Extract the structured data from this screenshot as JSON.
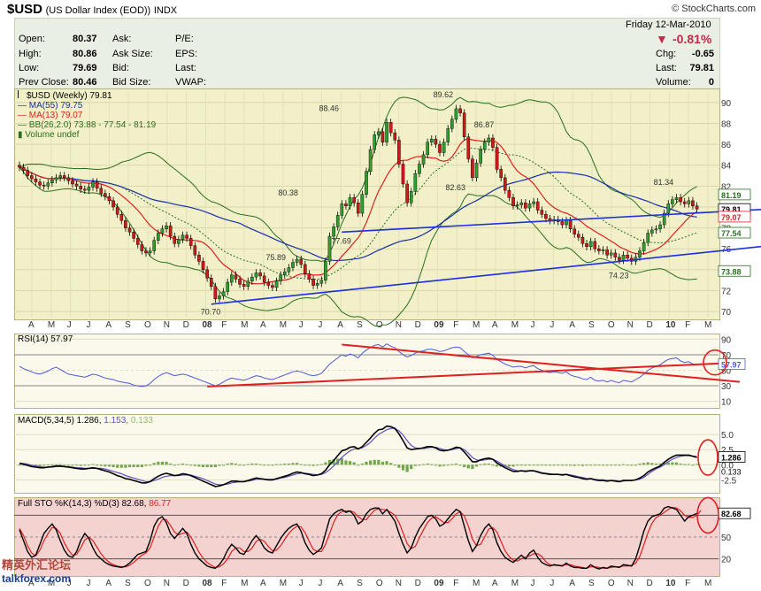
{
  "header": {
    "symbol": "$USD",
    "description": "(US Dollar Index (EOD))",
    "exchange": "INDX",
    "brand": "© StockCharts.com"
  },
  "quote": {
    "date": "Friday   12-Mar-2010",
    "change_pct": "-0.81%",
    "rows_left": [
      [
        "Open:",
        "80.37"
      ],
      [
        "High:",
        "80.86"
      ],
      [
        "Low:",
        "79.69"
      ],
      [
        "Prev Close:",
        "80.46"
      ]
    ],
    "rows_mid": [
      "Ask:",
      "Ask Size:",
      "Bid:",
      "Bid Size:"
    ],
    "rows_right": [
      "P/E:",
      "EPS:",
      "Last:",
      "VWAP:"
    ],
    "rows_far": [
      [
        "Chg:",
        "-0.65"
      ],
      [
        "Last:",
        "79.81"
      ],
      [
        "Volume:",
        "0"
      ]
    ]
  },
  "legend": {
    "price": "$USD (Weekly) 79.81",
    "ma55": "MA(55) 79.75",
    "ma13": "MA(13) 79.07",
    "bb": "BB(26,2.0) 73.88 - 77.54 - 81.19",
    "volume": "Volume undef",
    "rsi": "RSI(14) 57.97",
    "macd_a": "MACD(5,34,5) 1.286,",
    "macd_b": "1.153,",
    "macd_c": "0.133",
    "sto_a": "Full STO %K(14,3) %D(3) 82.68,",
    "sto_b": "86.77"
  },
  "colors": {
    "up": "#2e9e2e",
    "down": "#d01818",
    "ma55": "#1a2fa8",
    "ma13": "#e02020",
    "bb": "#2a6e20",
    "trend": "#1c2ee0",
    "rsi_line": "#4d5ad8",
    "red_trend": "#e02020",
    "macd": "#000000",
    "signal": "#6050c0",
    "hist": "#6ea84a",
    "circle": "#e02020"
  },
  "watermark": {
    "line1": "精英外汇论坛",
    "line2": "talkforex.com"
  },
  "chart_data": [
    {
      "type": "candlestick",
      "title": "$USD (Weekly) 79.81",
      "x_months": [
        "A",
        "M",
        "J",
        "J",
        "A",
        "S",
        "O",
        "N",
        "D",
        "08",
        "F",
        "M",
        "A",
        "M",
        "J",
        "J",
        "A",
        "S",
        "O",
        "N",
        "D",
        "09",
        "F",
        "M",
        "A",
        "M",
        "J",
        "J",
        "A",
        "S",
        "O",
        "N",
        "D",
        "10",
        "F",
        "M"
      ],
      "ylim": [
        69.5,
        91
      ],
      "y_ticks": [
        70,
        72,
        74,
        76,
        78,
        80,
        82,
        84,
        86,
        88,
        90
      ],
      "close_path": [
        83.8,
        83.5,
        83.0,
        82.7,
        82.4,
        82.1,
        82.0,
        82.3,
        82.6,
        82.8,
        83.0,
        82.8,
        82.5,
        82.2,
        82.0,
        81.7,
        81.6,
        81.9,
        82.4,
        81.8,
        81.3,
        81.0,
        80.6,
        80.0,
        79.3,
        78.7,
        78.0,
        77.6,
        77.0,
        76.4,
        75.8,
        75.6,
        75.8,
        76.8,
        77.5,
        77.9,
        78.2,
        77.2,
        76.5,
        76.9,
        77.3,
        77.0,
        76.3,
        75.4,
        74.8,
        74.0,
        73.2,
        72.4,
        71.2,
        71.5,
        71.9,
        72.8,
        73.5,
        73.1,
        72.6,
        72.4,
        72.9,
        73.3,
        73.7,
        73.4,
        72.8,
        72.5,
        72.3,
        72.9,
        73.5,
        73.8,
        74.2,
        74.7,
        75.0,
        74.5,
        73.6,
        73.1,
        72.5,
        72.7,
        73.0,
        74.8,
        77.2,
        78.1,
        79.2,
        80.3,
        80.1,
        80.9,
        80.4,
        79.4,
        81.2,
        83.4,
        85.5,
        86.9,
        87.2,
        86.2,
        88.1,
        87.1,
        86.4,
        84.1,
        82.2,
        80.4,
        81.5,
        83.2,
        84.1,
        85.0,
        86.2,
        86.5,
        86.0,
        85.2,
        86.2,
        87.5,
        88.4,
        89.4,
        89.0,
        86.7,
        84.6,
        82.8,
        84.2,
        85.5,
        86.2,
        86.6,
        85.7,
        83.6,
        82.8,
        81.6,
        80.9,
        80.1,
        80.2,
        80.4,
        79.9,
        80.3,
        80.5,
        79.7,
        79.3,
        78.9,
        78.7,
        78.8,
        78.6,
        78.3,
        78.7,
        77.9,
        77.4,
        77.1,
        76.5,
        76.2,
        76.7,
        76.0,
        75.8,
        75.9,
        75.4,
        75.6,
        75.2,
        74.9,
        75.4,
        75.1,
        74.8,
        75.2,
        75.8,
        76.6,
        77.5,
        77.8,
        77.9,
        78.3,
        79.4,
        80.3,
        80.7,
        80.9,
        80.5,
        80.3,
        80.6,
        80.1,
        79.8
      ],
      "annotations": [
        {
          "text": "88.46",
          "x": 76,
          "y": 89.2
        },
        {
          "text": "89.62",
          "x": 104,
          "y": 90.5
        },
        {
          "text": "86.87",
          "x": 114,
          "y": 87.6
        },
        {
          "text": "80.38",
          "x": 66,
          "y": 81.1
        },
        {
          "text": "82.63",
          "x": 107,
          "y": 81.6
        },
        {
          "text": "77.69",
          "x": 79,
          "y": 76.5
        },
        {
          "text": "75.89",
          "x": 63,
          "y": 74.9
        },
        {
          "text": "70.70",
          "x": 47,
          "y": 69.7
        },
        {
          "text": "81.34",
          "x": 158,
          "y": 82.1
        },
        {
          "text": "74.23",
          "x": 147,
          "y": 73.2
        }
      ],
      "right_tags": [
        {
          "text": "81.19",
          "color": "#2a6e20"
        },
        {
          "text": "79.81",
          "color": "#000000"
        },
        {
          "text": "79.07",
          "color": "#e02020"
        },
        {
          "text": "77.54",
          "color": "#2a6e20"
        },
        {
          "text": "73.88",
          "color": "#2a6e20"
        }
      ],
      "right_tag_values": [
        81.19,
        79.81,
        79.07,
        77.54,
        73.88
      ],
      "trendlines": [
        {
          "from": [
            47,
            70.7
          ],
          "to": [
            174,
            75.9
          ]
        },
        {
          "from": [
            79,
            77.6
          ],
          "to": [
            174,
            79.6
          ]
        }
      ]
    },
    {
      "type": "line",
      "title": "RSI(14) 57.97",
      "ylim": [
        5,
        95
      ],
      "y_ticks": [
        10,
        30,
        50,
        70,
        90
      ],
      "current": 57.97,
      "values": [
        55,
        52,
        50,
        48,
        46,
        45,
        47,
        49,
        52,
        54,
        51,
        48,
        45,
        44,
        43,
        42,
        41,
        43,
        45,
        44,
        42,
        40,
        39,
        38,
        36,
        35,
        34,
        33,
        31,
        30,
        29,
        30,
        33,
        38,
        42,
        45,
        47,
        45,
        43,
        44,
        45,
        44,
        42,
        40,
        38,
        36,
        34,
        32,
        30,
        32,
        35,
        38,
        40,
        39,
        38,
        37,
        39,
        41,
        43,
        42,
        40,
        39,
        38,
        40,
        42,
        44,
        46,
        48,
        49,
        48,
        46,
        44,
        43,
        44,
        46,
        52,
        58,
        62,
        66,
        70,
        68,
        71,
        69,
        66,
        72,
        76,
        79,
        82,
        83,
        80,
        84,
        81,
        79,
        74,
        70,
        67,
        69,
        72,
        74,
        75,
        77,
        77,
        76,
        74,
        75,
        77,
        79,
        80,
        79,
        74,
        70,
        66,
        68,
        70,
        71,
        72,
        69,
        64,
        61,
        58,
        56,
        54,
        55,
        55,
        53,
        55,
        56,
        52,
        50,
        48,
        47,
        48,
        47,
        46,
        48,
        44,
        42,
        41,
        39,
        38,
        41,
        37,
        36,
        37,
        35,
        37,
        35,
        34,
        37,
        36,
        35,
        38,
        41,
        45,
        50,
        53,
        55,
        57,
        61,
        64,
        65,
        66,
        62,
        60,
        61,
        58,
        58
      ]
    },
    {
      "type": "line",
      "title": "MACD(5,34,5) 1.286, 1.153, 0.133",
      "ylim": [
        -4.2,
        7.8
      ],
      "y_ticks": [
        -2.5,
        0,
        2.5,
        5.0
      ],
      "macd": [
        0.2,
        0.1,
        -0.1,
        -0.3,
        -0.4,
        -0.5,
        -0.5,
        -0.4,
        -0.3,
        -0.2,
        -0.2,
        -0.3,
        -0.4,
        -0.5,
        -0.6,
        -0.7,
        -0.7,
        -0.6,
        -0.5,
        -0.6,
        -0.8,
        -1.0,
        -1.2,
        -1.5,
        -1.8,
        -2.0,
        -2.3,
        -2.4,
        -2.6,
        -2.8,
        -3.0,
        -3.0,
        -2.8,
        -2.3,
        -1.9,
        -1.6,
        -1.4,
        -1.6,
        -1.8,
        -1.7,
        -1.5,
        -1.6,
        -1.8,
        -2.1,
        -2.4,
        -2.7,
        -3.0,
        -3.3,
        -3.6,
        -3.5,
        -3.3,
        -3.0,
        -2.7,
        -2.7,
        -2.8,
        -2.8,
        -2.6,
        -2.4,
        -2.2,
        -2.3,
        -2.4,
        -2.5,
        -2.5,
        -2.3,
        -2.1,
        -1.9,
        -1.7,
        -1.4,
        -1.2,
        -1.3,
        -1.5,
        -1.6,
        -1.8,
        -1.7,
        -1.5,
        -0.9,
        0.0,
        0.7,
        1.5,
        2.3,
        2.5,
        2.9,
        3.0,
        2.6,
        3.0,
        3.7,
        4.4,
        5.2,
        5.8,
        5.9,
        6.4,
        6.3,
        6.0,
        5.1,
        4.0,
        2.8,
        2.5,
        2.6,
        2.7,
        2.8,
        3.0,
        3.0,
        2.8,
        2.4,
        2.3,
        2.4,
        2.6,
        2.9,
        2.8,
        2.1,
        1.3,
        0.5,
        0.5,
        0.8,
        1.0,
        1.1,
        0.9,
        0.3,
        -0.1,
        -0.5,
        -0.8,
        -1.1,
        -1.1,
        -1.0,
        -1.1,
        -1.0,
        -1.0,
        -1.2,
        -1.4,
        -1.5,
        -1.6,
        -1.6,
        -1.6,
        -1.7,
        -1.6,
        -1.8,
        -2.0,
        -2.1,
        -2.3,
        -2.4,
        -2.3,
        -2.5,
        -2.6,
        -2.6,
        -2.7,
        -2.6,
        -2.7,
        -2.8,
        -2.6,
        -2.6,
        -2.6,
        -2.5,
        -2.2,
        -1.8,
        -1.2,
        -0.8,
        -0.5,
        -0.2,
        0.4,
        0.9,
        1.3,
        1.6,
        1.6,
        1.6,
        1.6,
        1.4,
        1.29
      ],
      "signal": [
        0.3,
        0.2,
        0.1,
        -0.1,
        -0.2,
        -0.3,
        -0.4,
        -0.4,
        -0.4,
        -0.3,
        -0.3,
        -0.3,
        -0.3,
        -0.4,
        -0.5,
        -0.5,
        -0.6,
        -0.6,
        -0.6,
        -0.6,
        -0.6,
        -0.7,
        -0.9,
        -1.1,
        -1.3,
        -1.5,
        -1.8,
        -2.0,
        -2.2,
        -2.4,
        -2.6,
        -2.8,
        -2.8,
        -2.6,
        -2.4,
        -2.1,
        -1.9,
        -1.8,
        -1.8,
        -1.8,
        -1.7,
        -1.7,
        -1.7,
        -1.9,
        -2.1,
        -2.3,
        -2.6,
        -2.9,
        -3.2,
        -3.3,
        -3.3,
        -3.2,
        -3.0,
        -2.9,
        -2.8,
        -2.8,
        -2.7,
        -2.6,
        -2.4,
        -2.4,
        -2.4,
        -2.4,
        -2.4,
        -2.4,
        -2.2,
        -2.1,
        -1.9,
        -1.7,
        -1.5,
        -1.4,
        -1.4,
        -1.5,
        -1.6,
        -1.7,
        -1.6,
        -1.3,
        -0.8,
        -0.2,
        0.5,
        1.2,
        1.8,
        2.3,
        2.6,
        2.7,
        2.8,
        3.2,
        3.7,
        4.4,
        5.0,
        5.4,
        5.8,
        6.0,
        6.0,
        5.6,
        4.9,
        4.0,
        3.2,
        2.8,
        2.7,
        2.7,
        2.8,
        2.9,
        2.9,
        2.7,
        2.5,
        2.4,
        2.5,
        2.7,
        2.8,
        2.5,
        1.9,
        1.2,
        0.8,
        0.7,
        0.8,
        0.9,
        0.9,
        0.6,
        0.2,
        -0.2,
        -0.5,
        -0.8,
        -1.0,
        -1.0,
        -1.0,
        -1.0,
        -1.0,
        -1.1,
        -1.3,
        -1.4,
        -1.5,
        -1.6,
        -1.6,
        -1.6,
        -1.6,
        -1.7,
        -1.8,
        -2.0,
        -2.1,
        -2.3,
        -2.3,
        -2.4,
        -2.5,
        -2.5,
        -2.6,
        -2.6,
        -2.6,
        -2.7,
        -2.7,
        -2.6,
        -2.6,
        -2.5,
        -2.4,
        -2.1,
        -1.6,
        -1.1,
        -0.7,
        -0.4,
        0.0,
        0.5,
        0.9,
        1.2,
        1.4,
        1.5,
        1.5,
        1.4,
        1.15
      ]
    },
    {
      "type": "line",
      "title": "Full STO %K(14,3) %D(3) 82.68, 86.77",
      "ylim": [
        0,
        100
      ],
      "y_ticks": [
        20,
        50,
        80
      ],
      "k": [
        60,
        45,
        30,
        22,
        25,
        40,
        55,
        62,
        68,
        60,
        45,
        32,
        24,
        22,
        30,
        45,
        55,
        48,
        35,
        25,
        20,
        15,
        12,
        10,
        9,
        8,
        10,
        14,
        20,
        26,
        28,
        30,
        45,
        65,
        75,
        78,
        70,
        55,
        48,
        55,
        62,
        55,
        40,
        28,
        20,
        15,
        10,
        8,
        7,
        12,
        20,
        32,
        40,
        35,
        28,
        26,
        35,
        45,
        52,
        45,
        35,
        30,
        28,
        38,
        48,
        56,
        62,
        66,
        68,
        58,
        42,
        32,
        26,
        30,
        35,
        55,
        75,
        82,
        86,
        88,
        84,
        86,
        80,
        68,
        72,
        82,
        88,
        90,
        90,
        82,
        88,
        80,
        72,
        55,
        40,
        28,
        35,
        50,
        62,
        70,
        78,
        80,
        75,
        65,
        68,
        75,
        82,
        88,
        85,
        65,
        45,
        30,
        38,
        52,
        62,
        68,
        60,
        42,
        30,
        22,
        18,
        15,
        20,
        25,
        20,
        28,
        32,
        22,
        15,
        12,
        10,
        12,
        11,
        10,
        14,
        10,
        8,
        8,
        7,
        7,
        12,
        8,
        6,
        8,
        7,
        10,
        9,
        8,
        12,
        11,
        10,
        20,
        38,
        58,
        72,
        78,
        80,
        82,
        90,
        92,
        90,
        88,
        80,
        72,
        78,
        80,
        82.68
      ],
      "d": [
        62,
        52,
        38,
        28,
        24,
        32,
        45,
        55,
        63,
        62,
        55,
        42,
        32,
        25,
        26,
        35,
        46,
        50,
        45,
        36,
        27,
        20,
        15,
        12,
        10,
        9,
        9,
        11,
        15,
        20,
        25,
        28,
        35,
        50,
        65,
        74,
        74,
        66,
        57,
        53,
        55,
        57,
        50,
        40,
        29,
        21,
        15,
        11,
        8,
        9,
        13,
        20,
        30,
        35,
        35,
        30,
        30,
        35,
        44,
        47,
        44,
        37,
        31,
        32,
        38,
        47,
        55,
        61,
        65,
        64,
        56,
        44,
        33,
        30,
        30,
        40,
        55,
        70,
        81,
        85,
        86,
        86,
        84,
        78,
        74,
        74,
        81,
        87,
        89,
        88,
        87,
        84,
        80,
        70,
        56,
        41,
        34,
        37,
        49,
        60,
        70,
        76,
        78,
        74,
        70,
        70,
        75,
        82,
        85,
        79,
        65,
        47,
        38,
        40,
        50,
        61,
        63,
        57,
        44,
        31,
        23,
        18,
        17,
        20,
        22,
        24,
        27,
        27,
        23,
        16,
        12,
        11,
        11,
        11,
        12,
        12,
        10,
        9,
        8,
        7,
        9,
        9,
        8,
        7,
        7,
        8,
        9,
        9,
        10,
        10,
        11,
        14,
        23,
        39,
        56,
        69,
        77,
        80,
        84,
        88,
        91,
        90,
        86,
        80,
        77,
        77,
        80,
        86.77
      ]
    }
  ]
}
